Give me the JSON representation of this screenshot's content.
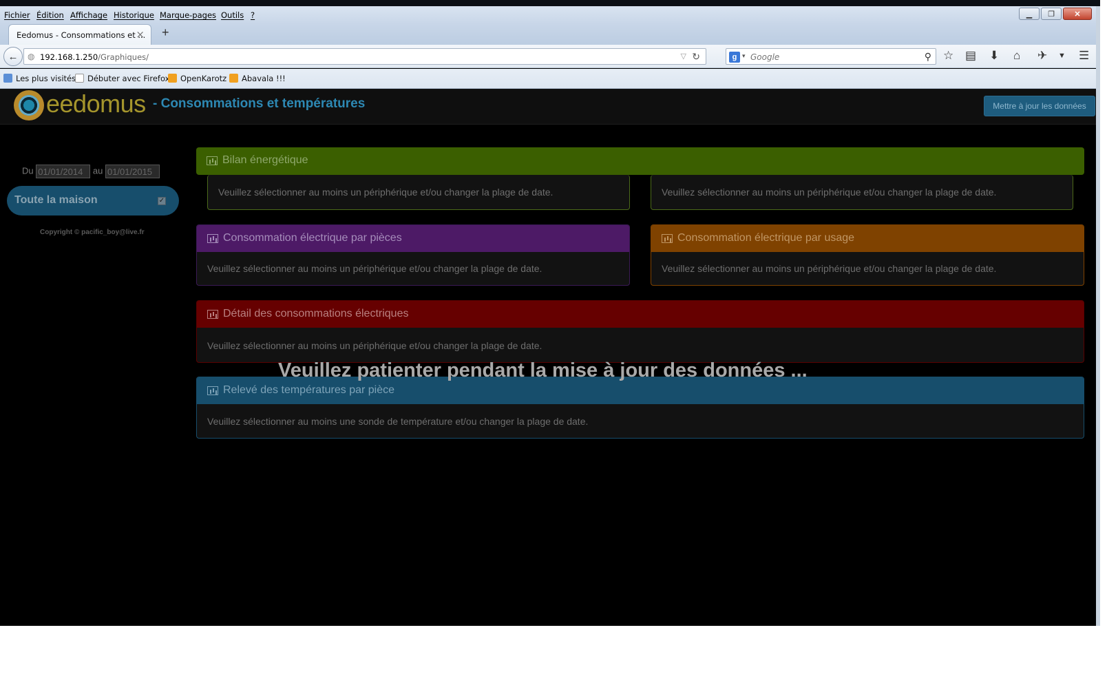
{
  "browser": {
    "menu": [
      "Fichier",
      "Édition",
      "Affichage",
      "Historique",
      "Marque-pages",
      "Outils",
      "?"
    ],
    "tab_title": "Eedomus - Consommations et ...",
    "tab_close": "×",
    "new_tab": "+",
    "url_host": "192.168.1.250",
    "url_path": "/Graphiques/",
    "search_placeholder": "Google",
    "bookmarks": [
      "Les plus visités",
      "Débuter avec Firefox",
      "OpenKarotz",
      "Abavala !!!"
    ]
  },
  "header": {
    "brand": "eedomus",
    "subtitle": "- Consommations et températures",
    "update_button": "Mettre à jour les données"
  },
  "sidebar": {
    "from_label": "Du",
    "from_date": "01/01/2014",
    "to_label": "au",
    "to_date": "01/01/2015",
    "house_button": "Toute la maison",
    "copyright": "Copyright © pacific_boy@live.fr"
  },
  "panels": {
    "bilan": {
      "title": "Bilan énergétique",
      "left_msg": "Veuillez sélectionner au moins un périphérique et/ou changer la plage de date.",
      "right_msg": "Veuillez sélectionner au moins un périphérique et/ou changer la plage de date."
    },
    "pieces": {
      "title": "Consommation électrique par pièces",
      "msg": "Veuillez sélectionner au moins un périphérique et/ou changer la plage de date."
    },
    "usage": {
      "title": "Consommation électrique par usage",
      "msg": "Veuillez sélectionner au moins un périphérique et/ou changer la plage de date."
    },
    "detail": {
      "title": "Détail des consommations électriques",
      "msg": "Veuillez sélectionner au moins un périphérique et/ou changer la plage de date."
    },
    "temperatures": {
      "title": "Relevé des températures par pièce",
      "msg": "Veuillez sélectionner au moins une sonde de température et/ou changer la plage de date."
    }
  },
  "overlay": "Veuillez patienter pendant la mise à jour des données ...",
  "colors": {
    "bilan": "#3b5f00",
    "pieces": "#4d1a66",
    "usage": "#7f4200",
    "detail": "#660000",
    "temperatures": "#174e6c"
  }
}
